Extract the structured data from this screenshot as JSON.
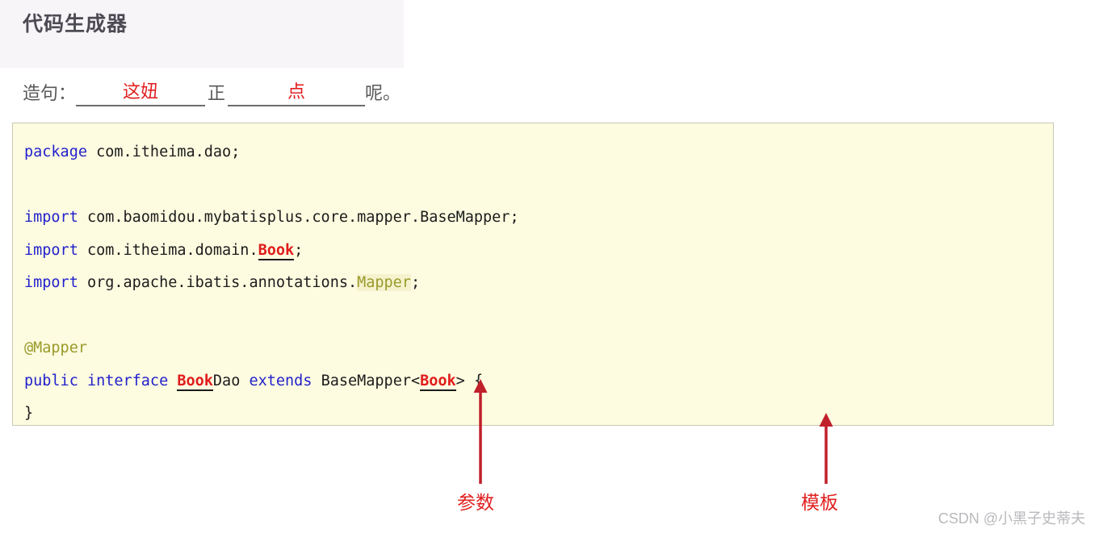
{
  "page": {
    "title": "代码生成器"
  },
  "sentence": {
    "label": "造句：",
    "blank_1": "这妞",
    "middle": "正",
    "blank_2": "点",
    "ending": "呢。"
  },
  "code": {
    "language": "java",
    "lines": [
      {
        "id": "line-1",
        "tokens": [
          {
            "text": "package",
            "style": "kw"
          },
          {
            "text": " com.itheima.dao;",
            "style": "plain"
          }
        ]
      },
      {
        "id": "line-2",
        "tokens": []
      },
      {
        "id": "line-3",
        "tokens": [
          {
            "text": "import",
            "style": "kw"
          },
          {
            "text": " com.baomidou.mybatisplus.core.mapper.BaseMapper;",
            "style": "plain"
          }
        ]
      },
      {
        "id": "line-4",
        "tokens": [
          {
            "text": "import",
            "style": "kw"
          },
          {
            "text": " com.itheima.domain.",
            "style": "plain"
          },
          {
            "text": "Book",
            "style": "book"
          },
          {
            "text": ";",
            "style": "plain"
          }
        ]
      },
      {
        "id": "line-5",
        "tokens": [
          {
            "text": "import",
            "style": "kw"
          },
          {
            "text": " org.apache.ibatis.annotations.",
            "style": "plain"
          },
          {
            "text": "Mapper",
            "style": "anno"
          },
          {
            "text": ";",
            "style": "plain"
          }
        ]
      },
      {
        "id": "line-6",
        "tokens": []
      },
      {
        "id": "line-7",
        "tokens": [
          {
            "text": "@Mapper",
            "style": "anno-bare"
          }
        ]
      },
      {
        "id": "line-8",
        "tokens": [
          {
            "text": "public",
            "style": "kw"
          },
          {
            "text": " ",
            "style": "plain"
          },
          {
            "text": "interface",
            "style": "kw"
          },
          {
            "text": " ",
            "style": "plain"
          },
          {
            "text": "Book",
            "style": "book"
          },
          {
            "text": "Dao ",
            "style": "plain"
          },
          {
            "text": "extends",
            "style": "kw"
          },
          {
            "text": " BaseMapper<",
            "style": "plain"
          },
          {
            "text": "Book",
            "style": "book"
          },
          {
            "text": "> {",
            "style": "plain"
          }
        ]
      },
      {
        "id": "line-9",
        "tokens": [
          {
            "text": "}",
            "style": "plain"
          }
        ]
      }
    ]
  },
  "annotations": {
    "arrow_color": "#c0202a",
    "items": [
      {
        "id": "parameter",
        "label": "参数",
        "points_to": "Book type argument"
      },
      {
        "id": "template",
        "label": "模板",
        "points_to": "code template block"
      }
    ]
  },
  "watermark": {
    "text": "CSDN @小黑子史蒂夫"
  },
  "colors": {
    "code_background": "#fdfbe0",
    "code_border": "#c9c9b4",
    "keyword": "#2222cc",
    "annotation": "#9a9a2a",
    "highlight_red": "#e01b1b",
    "title": "#4c4a52"
  }
}
